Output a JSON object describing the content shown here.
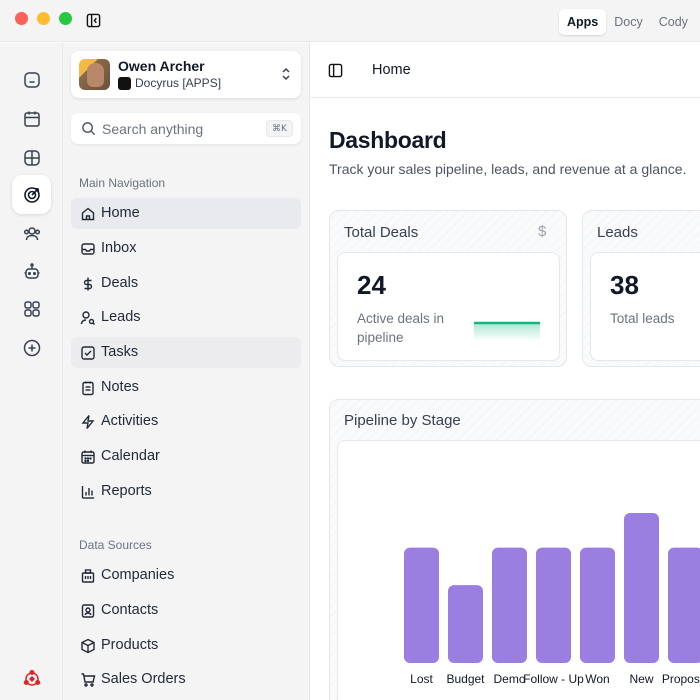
{
  "titlebar": {
    "tabs": [
      {
        "label": "Apps",
        "active": true
      },
      {
        "label": "Docy",
        "active": false
      },
      {
        "label": "Cody",
        "active": false
      }
    ]
  },
  "rail": {
    "icons": [
      "home-icon",
      "calendar-icon",
      "grid-icon",
      "target-icon",
      "users-icon",
      "bot-icon",
      "apps-icon",
      "plus-circle-icon"
    ],
    "active_index": 3
  },
  "user": {
    "name": "Owen Archer",
    "org": "Docyrus [APPS]"
  },
  "search": {
    "placeholder": "Search anything",
    "shortcut": "⌘K"
  },
  "nav": {
    "main_label": "Main Navigation",
    "main_items": [
      {
        "label": "Home",
        "icon": "home-icon"
      },
      {
        "label": "Inbox",
        "icon": "inbox-icon"
      },
      {
        "label": "Deals",
        "icon": "dollar-icon"
      },
      {
        "label": "Leads",
        "icon": "user-search-icon"
      },
      {
        "label": "Tasks",
        "icon": "checkbox-icon"
      },
      {
        "label": "Notes",
        "icon": "notes-icon"
      },
      {
        "label": "Activities",
        "icon": "lightning-icon"
      },
      {
        "label": "Calendar",
        "icon": "calendar-icon"
      },
      {
        "label": "Reports",
        "icon": "bar-chart-icon"
      }
    ],
    "data_label": "Data Sources",
    "data_items": [
      {
        "label": "Companies",
        "icon": "building-icon"
      },
      {
        "label": "Contacts",
        "icon": "contact-card-icon"
      },
      {
        "label": "Products",
        "icon": "box-icon"
      },
      {
        "label": "Sales Orders",
        "icon": "cart-icon"
      }
    ]
  },
  "main": {
    "breadcrumb": "Home",
    "title": "Dashboard",
    "subtitle": "Track your sales pipeline, leads, and revenue at a glance.",
    "cards": [
      {
        "title": "Total Deals",
        "symbol": "$",
        "value": "24",
        "desc": "Active deals in pipeline"
      },
      {
        "title": "Leads",
        "symbol": "",
        "value": "38",
        "desc": "Total leads"
      }
    ]
  },
  "chart_data": {
    "type": "bar",
    "title": "Pipeline by Stage",
    "categories": [
      "Lost",
      "Budget",
      "Demo",
      "Follow - Up",
      "Won",
      "New",
      "Proposal"
    ],
    "values": [
      4,
      2.7,
      4,
      4,
      4,
      5.2,
      4
    ],
    "bar_color": "#9b7fe0"
  },
  "colors": {
    "accent": "#9b7fe0",
    "spark": "#10b981"
  }
}
